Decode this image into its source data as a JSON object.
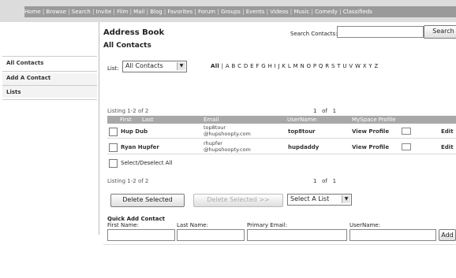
{
  "nav": {
    "items": [
      "Home",
      "Browse",
      "Search",
      "Invite",
      "Film",
      "Mail",
      "Blog",
      "Favorites",
      "Forum",
      "Groups",
      "Events",
      "Videos",
      "Music",
      "Comedy",
      "Classifieds"
    ]
  },
  "header": {
    "title": "Address Book",
    "subtitle": "All Contacts",
    "search_label": "Search Contacts:",
    "search_value": "",
    "search_button": "Search"
  },
  "sidebar": {
    "items": [
      {
        "label": "All Contacts"
      },
      {
        "label": "Add A Contact"
      },
      {
        "label": "Lists"
      }
    ]
  },
  "filter": {
    "list_label": "List:",
    "list_selected": "All Contacts",
    "alphabet": [
      "All",
      "|",
      "A",
      "B",
      "C",
      "D",
      "E",
      "F",
      "G",
      "H",
      "I",
      "J",
      "K",
      "L",
      "M",
      "N",
      "O",
      "P",
      "Q",
      "R",
      "S",
      "T",
      "U",
      "V",
      "W",
      "X",
      "Y",
      "Z"
    ]
  },
  "listing": {
    "top_label": "Listing 1-2 of 2",
    "bottom_label": "Listing 1-2 of 2",
    "page_current": "1",
    "page_of": "of",
    "page_total": "1"
  },
  "table": {
    "headers": {
      "first": "First",
      "last": "Last",
      "email": "Email",
      "username": "UserName:",
      "myspace": "MySpace Profile"
    },
    "rows": [
      {
        "name": "Hup Dub",
        "email_line1": "top8tour",
        "email_line2": "@hupshoopty.com",
        "username": "top8tour",
        "profile": "View Profile",
        "edit": "Edit"
      },
      {
        "name": "Ryan Hupfer",
        "email_line1": "rhupfer",
        "email_line2": "@hupshoopty.com",
        "username": "hupdaddy",
        "profile": "View Profile",
        "edit": "Edit"
      }
    ],
    "select_all": "Select/Deselect All"
  },
  "actions": {
    "delete_selected": "Delete Selected",
    "delete_selected_to": "Delete Selected >>",
    "list_select": "Select A List"
  },
  "quick_add": {
    "title": "Quick Add Contact",
    "first_name": "First Name:",
    "last_name": "Last Name:",
    "primary_email": "Primary Email:",
    "username": "UserName:",
    "add_button": "Add"
  }
}
